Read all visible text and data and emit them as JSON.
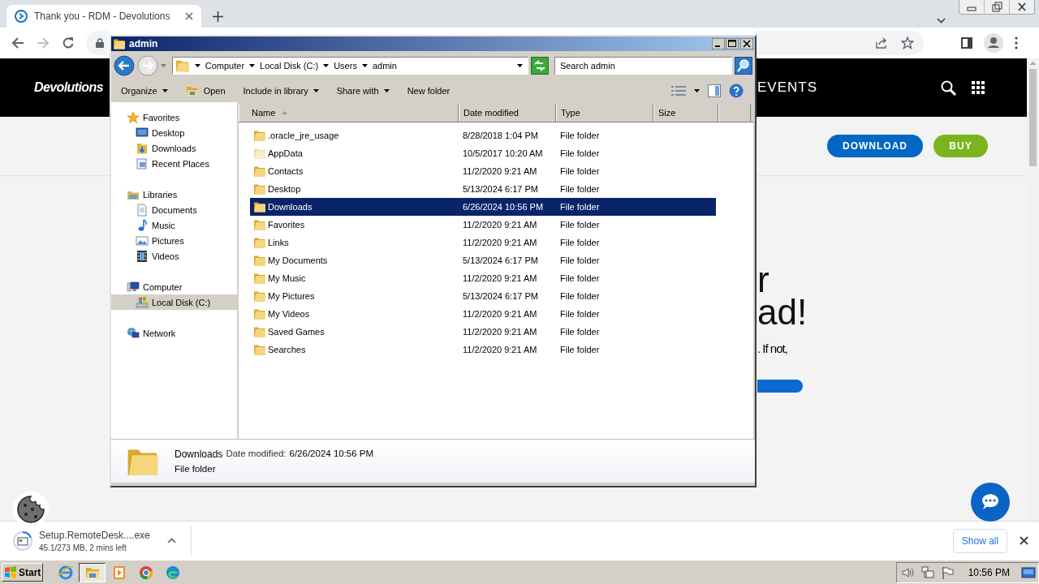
{
  "browser": {
    "tab": {
      "title": "Thank you - RDM - Devolutions"
    }
  },
  "page": {
    "logo": "Devolutions",
    "nav_item": "EVENTS",
    "buttons": [
      {
        "label": "DOWNLOAD",
        "color": "#0067c5"
      },
      {
        "label": "BUY",
        "color": "#7ab51d"
      }
    ],
    "heading": [
      "r",
      "ad!"
    ],
    "text": ". If not,"
  },
  "explorer": {
    "title": "admin",
    "breadcrumb": [
      "Computer",
      "Local Disk (C:)",
      "Users",
      "admin"
    ],
    "search": {
      "placeholder": "Search admin"
    },
    "toolbar": [
      {
        "label": "Organize",
        "kind": "menu",
        "dropdown": true
      },
      {
        "label": "Open",
        "kind": "open",
        "dropdown": false
      },
      {
        "label": "Include in library",
        "kind": "menu",
        "dropdown": true
      },
      {
        "label": "Share with",
        "kind": "menu",
        "dropdown": true
      },
      {
        "label": "New folder",
        "kind": "menu",
        "dropdown": false
      }
    ],
    "nav": [
      {
        "label": "Favorites",
        "kind": "star",
        "selected": false,
        "children": [
          {
            "label": "Desktop",
            "kind": "monitor",
            "selected": false
          },
          {
            "label": "Downloads",
            "kind": "downloads",
            "selected": false
          },
          {
            "label": "Recent Places",
            "kind": "recent",
            "selected": false
          }
        ]
      },
      {
        "label": "Libraries",
        "kind": "library",
        "selected": false,
        "children": [
          {
            "label": "Documents",
            "kind": "document",
            "selected": false
          },
          {
            "label": "Music",
            "kind": "music",
            "selected": false
          },
          {
            "label": "Pictures",
            "kind": "picture",
            "selected": false
          },
          {
            "label": "Videos",
            "kind": "video",
            "selected": false
          }
        ]
      },
      {
        "label": "Computer",
        "kind": "computer",
        "selected": false,
        "children": [
          {
            "label": "Local Disk (C:)",
            "kind": "disk",
            "selected": true
          }
        ]
      },
      {
        "label": "Network",
        "kind": "network",
        "selected": false
      }
    ],
    "columns": [
      "Name",
      "Date modified",
      "Type",
      "Size"
    ],
    "rows": [
      {
        "name": ".oracle_jre_usage",
        "date": "8/28/2018 1:04 PM",
        "type": "File folder",
        "hidden": false,
        "selected": false
      },
      {
        "name": "AppData",
        "date": "10/5/2017 10:20 AM",
        "type": "File folder",
        "hidden": true,
        "selected": false
      },
      {
        "name": "Contacts",
        "date": "11/2/2020 9:21 AM",
        "type": "File folder",
        "hidden": false,
        "selected": false
      },
      {
        "name": "Desktop",
        "date": "5/13/2024 6:17 PM",
        "type": "File folder",
        "hidden": false,
        "selected": false
      },
      {
        "name": "Downloads",
        "date": "6/26/2024 10:56 PM",
        "type": "File folder",
        "hidden": false,
        "selected": true
      },
      {
        "name": "Favorites",
        "date": "11/2/2020 9:21 AM",
        "type": "File folder",
        "hidden": false,
        "selected": false
      },
      {
        "name": "Links",
        "date": "11/2/2020 9:21 AM",
        "type": "File folder",
        "hidden": false,
        "selected": false
      },
      {
        "name": "My Documents",
        "date": "5/13/2024 6:17 PM",
        "type": "File folder",
        "hidden": false,
        "selected": false
      },
      {
        "name": "My Music",
        "date": "11/2/2020 9:21 AM",
        "type": "File folder",
        "hidden": false,
        "selected": false
      },
      {
        "name": "My Pictures",
        "date": "5/13/2024 6:17 PM",
        "type": "File folder",
        "hidden": false,
        "selected": false
      },
      {
        "name": "My Videos",
        "date": "11/2/2020 9:21 AM",
        "type": "File folder",
        "hidden": false,
        "selected": false
      },
      {
        "name": "Saved Games",
        "date": "11/2/2020 9:21 AM",
        "type": "File folder",
        "hidden": false,
        "selected": false
      },
      {
        "name": "Searches",
        "date": "11/2/2020 9:21 AM",
        "type": "File folder",
        "hidden": false,
        "selected": false
      }
    ],
    "details": {
      "name": "Downloads",
      "date_label": "Date modified:",
      "date": "6/26/2024 10:56 PM",
      "type": "File folder"
    }
  },
  "download_bar": {
    "file_name": "Setup.RemoteDesk....exe",
    "status": "45.1/273 MB, 2 mins left",
    "show_all": "Show all"
  },
  "taskbar": {
    "start": "Start",
    "apps": [
      {
        "kind": "ie",
        "selected": false
      },
      {
        "kind": "explorer",
        "selected": true
      },
      {
        "kind": "media",
        "selected": false
      },
      {
        "kind": "chrome",
        "selected": false
      },
      {
        "kind": "edge",
        "selected": false
      }
    ],
    "clock": "10:56 PM"
  }
}
